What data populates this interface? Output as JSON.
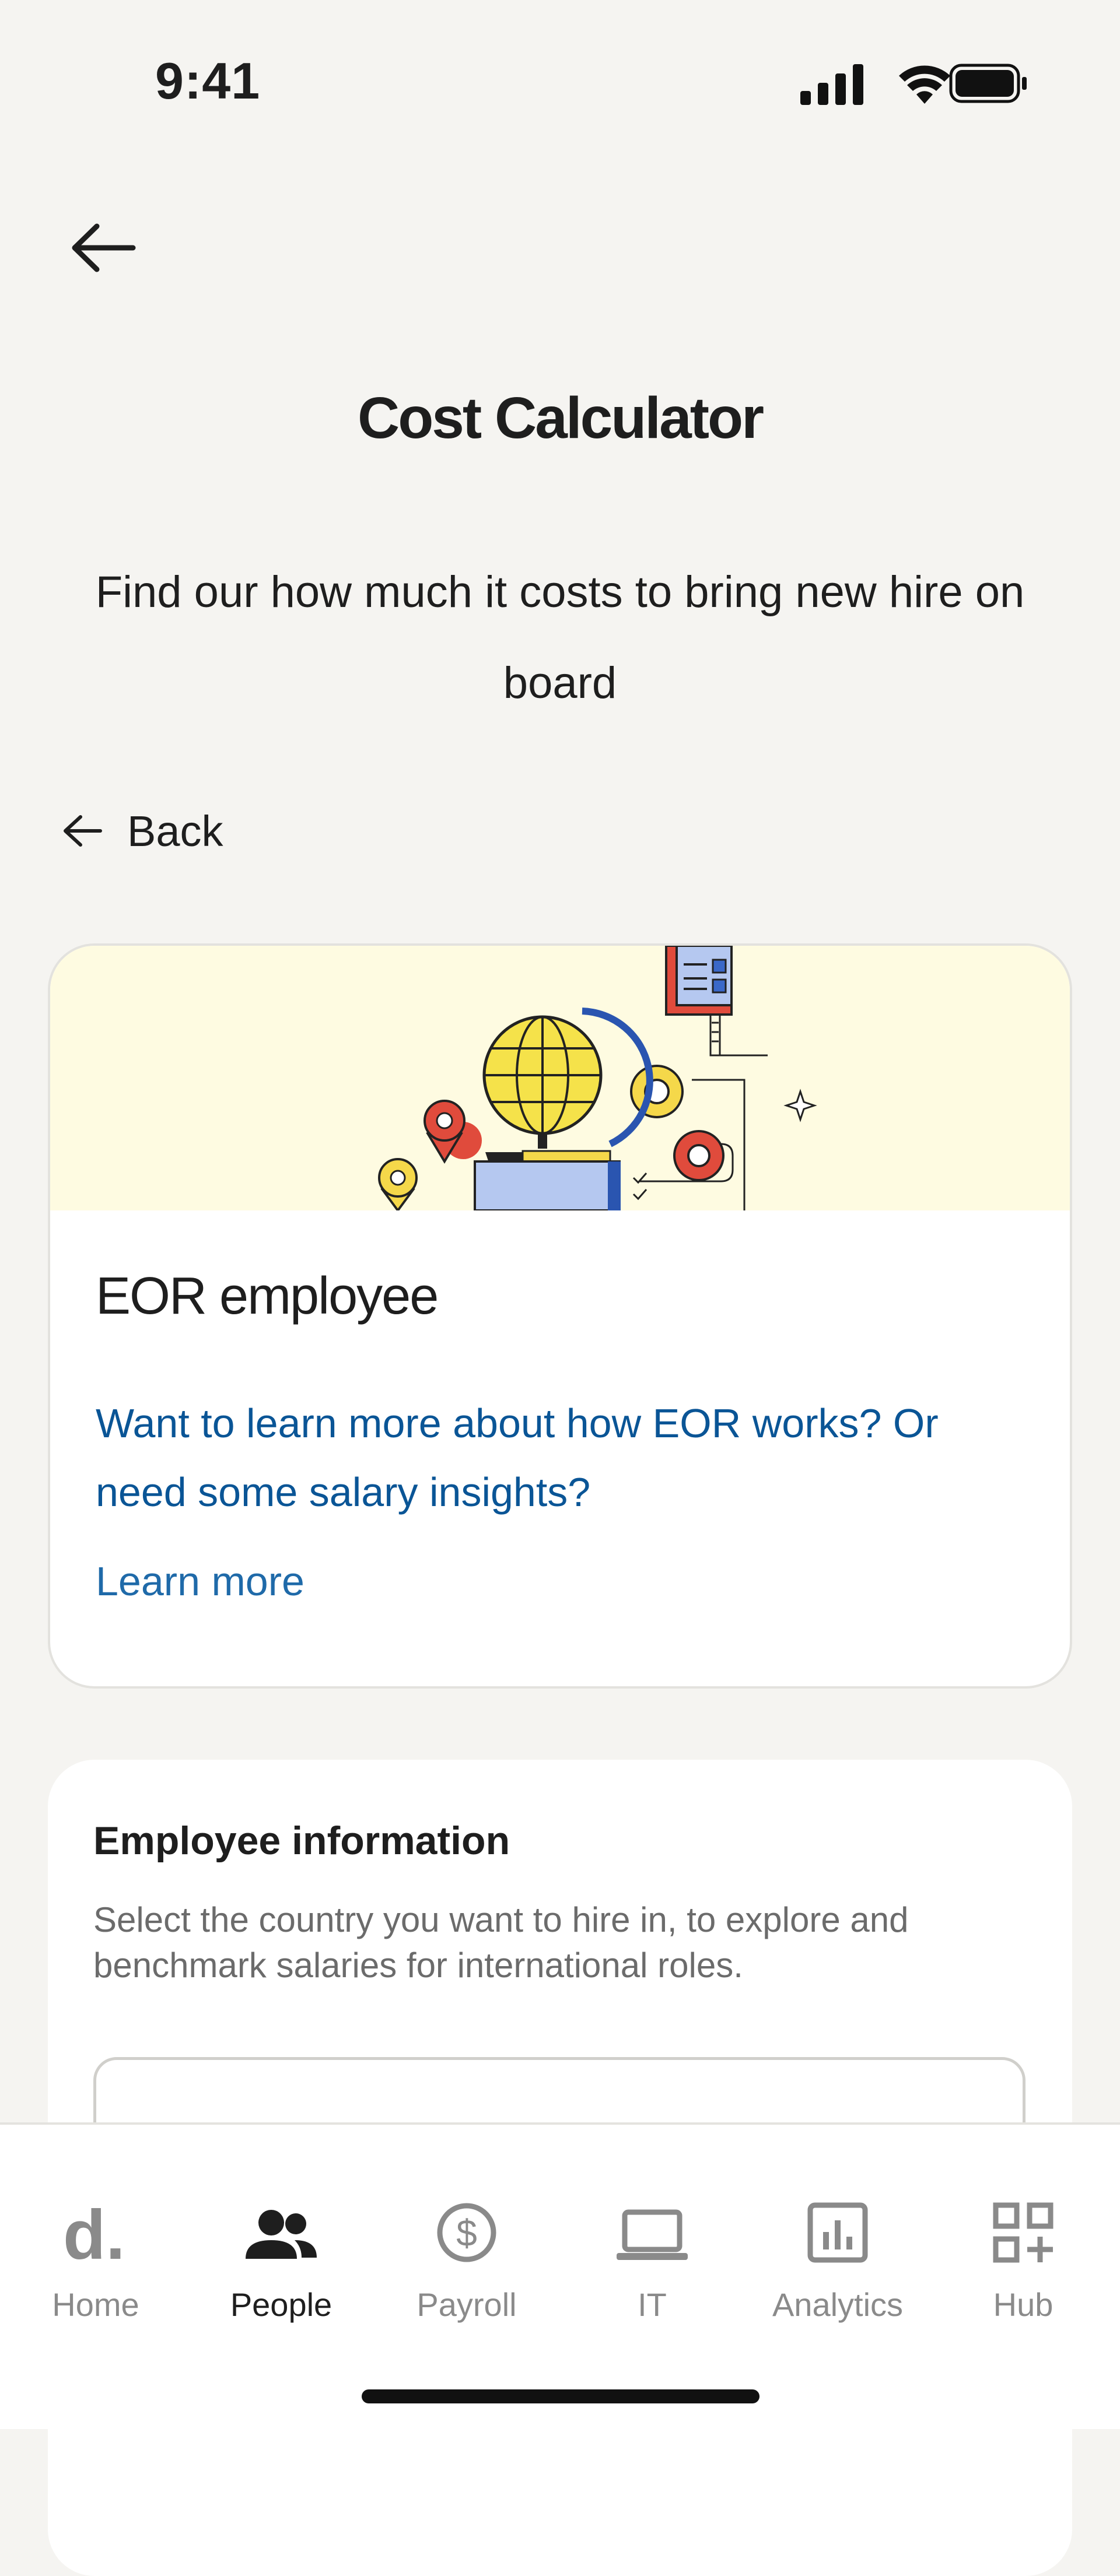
{
  "status_bar": {
    "time": "9:41"
  },
  "header": {
    "title": "Cost Calculator",
    "subtitle": "Find our how much it costs to bring new hire on board"
  },
  "back_link": {
    "label": "Back"
  },
  "eor_card": {
    "title": "EOR employee",
    "description": "Want to learn more about how EOR works? Or need some salary insights?",
    "link_label": "Learn more"
  },
  "employee_info": {
    "title": "Employee information",
    "description": "Select the country you want to hire in, to explore and benchmark salaries for international roles."
  },
  "bottom_nav": {
    "items": [
      {
        "label": "Home",
        "icon": "deel-logo-icon"
      },
      {
        "label": "People",
        "icon": "people-icon",
        "active": true
      },
      {
        "label": "Payroll",
        "icon": "dollar-circle-icon"
      },
      {
        "label": "IT",
        "icon": "laptop-icon"
      },
      {
        "label": "Analytics",
        "icon": "bar-chart-icon"
      },
      {
        "label": "Hub",
        "icon": "grid-plus-icon"
      }
    ]
  },
  "colors": {
    "background": "#f5f4f1",
    "link": "#0a5596",
    "banner": "#fefbe1"
  }
}
